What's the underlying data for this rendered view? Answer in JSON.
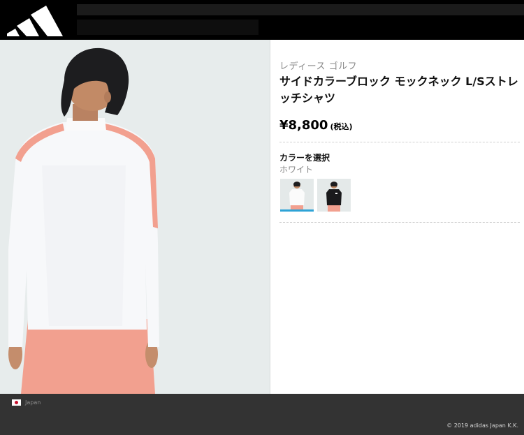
{
  "header": {
    "logo_icon": "adidas-three-stripes-logo"
  },
  "product": {
    "category": "レディース ゴルフ",
    "title": "サイドカラーブロック モックネック L/Sストレッチシャツ",
    "price": "¥8,800",
    "tax_note": "(税込)",
    "color_label": "カラーを選択",
    "selected_color": "ホワイト",
    "swatches": [
      {
        "color": "white",
        "selected": true
      },
      {
        "color": "black",
        "selected": false
      }
    ]
  },
  "footer": {
    "country": "Japan",
    "copyright": "© 2019 adidas Japan K.K."
  },
  "colors": {
    "header_bg": "#000000",
    "footer_bg": "#333333",
    "accent": "#2ea3d6",
    "photo_bg": "#e7ecec",
    "coral": "#f2a08f"
  }
}
